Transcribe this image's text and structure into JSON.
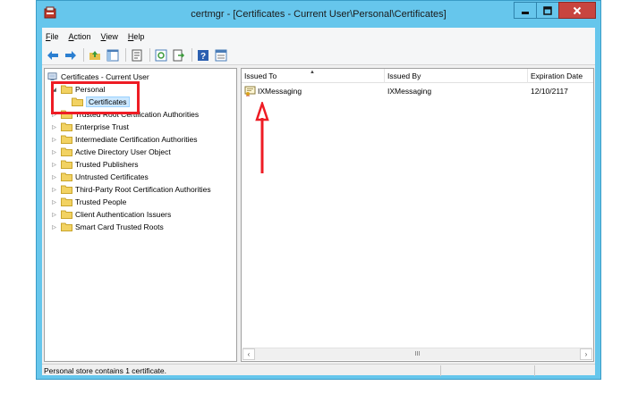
{
  "window": {
    "title": "certmgr - [Certificates - Current User\\Personal\\Certificates]",
    "caption_buttons": [
      "minimize-icon",
      "maximize-icon",
      "close-icon"
    ]
  },
  "menu": [
    {
      "key": "F",
      "rest": "ile"
    },
    {
      "key": "A",
      "rest": "ction"
    },
    {
      "key": "V",
      "rest": "iew"
    },
    {
      "key": "H",
      "rest": "elp"
    }
  ],
  "toolbar": [
    "back-icon",
    "forward-icon",
    "up-folder-icon",
    "show-hide-tree-icon",
    "properties-icon",
    "refresh-icon",
    "export-list-icon",
    "help-icon",
    "console-icon"
  ],
  "tree": {
    "root": "Certificates - Current User",
    "personal": "Personal",
    "certificates": "Certificates",
    "stores": [
      "Trusted Root Certification Authorities",
      "Enterprise Trust",
      "Intermediate Certification Authorities",
      "Active Directory User Object",
      "Trusted Publishers",
      "Untrusted Certificates",
      "Third-Party Root Certification Authorities",
      "Trusted People",
      "Client Authentication Issuers",
      "Smart Card Trusted Roots"
    ]
  },
  "list": {
    "columns": [
      "Issued To",
      "Issued By",
      "Expiration Date"
    ],
    "sorted_column": "Issued To",
    "rows": [
      {
        "issued_to": "IXMessaging",
        "issued_by": "IXMessaging",
        "expiration": "12/10/2117"
      }
    ],
    "scroll_thumb": "III"
  },
  "status": "Personal store contains 1 certificate.",
  "colors": {
    "titlebar": "#66c6ec",
    "close_button": "#c8453f",
    "annotation": "#ee1c24",
    "folder": "#f2d262"
  }
}
